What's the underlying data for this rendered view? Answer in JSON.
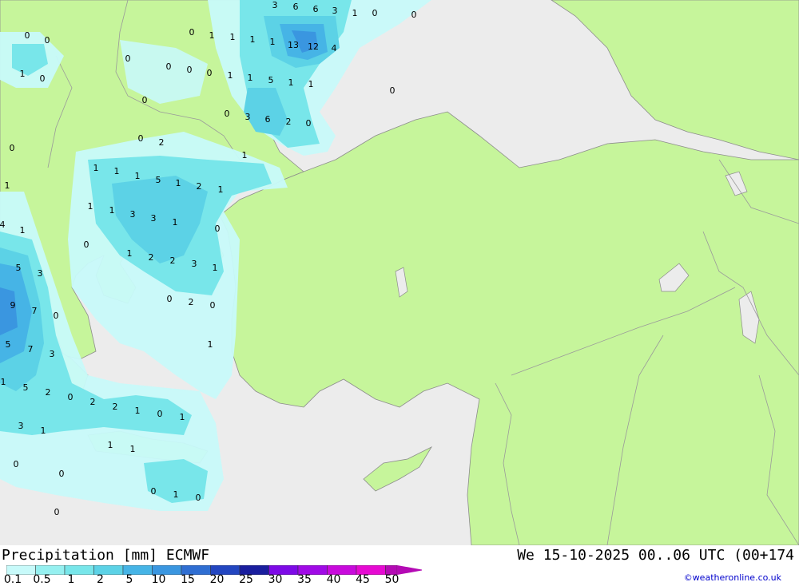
{
  "title": "Precipitation [mm] ECMWF",
  "valid": "We 15-10-2025 00..06 UTC (00+174",
  "credit": "©weatheronline.co.uk",
  "colors": {
    "sea": "#ececec",
    "land": "#c6f59b",
    "border": "#9a9a9a",
    "coast": "#8c8c8c"
  },
  "legend": {
    "labels": [
      "0.1",
      "0.5",
      "1",
      "2",
      "5",
      "10",
      "15",
      "20",
      "25",
      "30",
      "35",
      "40",
      "45",
      "50"
    ],
    "colors": [
      "#c8fafa",
      "#96f0f0",
      "#78e6ea",
      "#5cd2e6",
      "#46b4e6",
      "#3a96e0",
      "#2f6ed2",
      "#2346c0",
      "#1a1e9e",
      "#7d0ae6",
      "#a00ae6",
      "#c80adc",
      "#e60ad2",
      "#b40ab4"
    ]
  },
  "map_values": [
    {
      "v": "3"
    },
    {
      "v": "6"
    },
    {
      "v": "6"
    },
    {
      "v": "3"
    },
    {
      "v": "1"
    },
    {
      "v": "0"
    },
    {
      "v": "0"
    },
    {
      "v": "0"
    },
    {
      "v": "0"
    },
    {
      "v": "0"
    },
    {
      "v": "1"
    },
    {
      "v": "1"
    },
    {
      "v": "1"
    },
    {
      "v": "1"
    },
    {
      "v": "13"
    },
    {
      "v": "12"
    },
    {
      "v": "4"
    },
    {
      "v": "0"
    },
    {
      "v": "1"
    },
    {
      "v": "0"
    },
    {
      "v": "0"
    },
    {
      "v": "0"
    },
    {
      "v": "0"
    },
    {
      "v": "1"
    },
    {
      "v": "1"
    },
    {
      "v": "5"
    },
    {
      "v": "1"
    },
    {
      "v": "1"
    },
    {
      "v": "0"
    },
    {
      "v": "0"
    },
    {
      "v": "0"
    },
    {
      "v": "3"
    },
    {
      "v": "6"
    },
    {
      "v": "2"
    },
    {
      "v": "0"
    },
    {
      "v": "0"
    },
    {
      "v": "0"
    },
    {
      "v": "2"
    },
    {
      "v": "1"
    },
    {
      "v": "1"
    },
    {
      "v": "1"
    },
    {
      "v": "1"
    },
    {
      "v": "5"
    },
    {
      "v": "1"
    },
    {
      "v": "2"
    },
    {
      "v": "1"
    },
    {
      "v": "1"
    },
    {
      "v": "1"
    },
    {
      "v": "1"
    },
    {
      "v": "3"
    },
    {
      "v": "3"
    },
    {
      "v": "1"
    },
    {
      "v": "4"
    },
    {
      "v": "1"
    },
    {
      "v": "0"
    },
    {
      "v": "0"
    },
    {
      "v": "1"
    },
    {
      "v": "2"
    },
    {
      "v": "2"
    },
    {
      "v": "3"
    },
    {
      "v": "1"
    },
    {
      "v": "5"
    },
    {
      "v": "3"
    },
    {
      "v": "0"
    },
    {
      "v": "2"
    },
    {
      "v": "0"
    },
    {
      "v": "9"
    },
    {
      "v": "7"
    },
    {
      "v": "0"
    },
    {
      "v": "1"
    },
    {
      "v": "5"
    },
    {
      "v": "7"
    },
    {
      "v": "3"
    },
    {
      "v": "1"
    },
    {
      "v": "5"
    },
    {
      "v": "2"
    },
    {
      "v": "0"
    },
    {
      "v": "2"
    },
    {
      "v": "2"
    },
    {
      "v": "1"
    },
    {
      "v": "0"
    },
    {
      "v": "1"
    },
    {
      "v": "3"
    },
    {
      "v": "1"
    },
    {
      "v": "1"
    },
    {
      "v": "1"
    },
    {
      "v": "0"
    },
    {
      "v": "0"
    },
    {
      "v": "0"
    },
    {
      "v": "1"
    },
    {
      "v": "0"
    },
    {
      "v": "0"
    }
  ]
}
